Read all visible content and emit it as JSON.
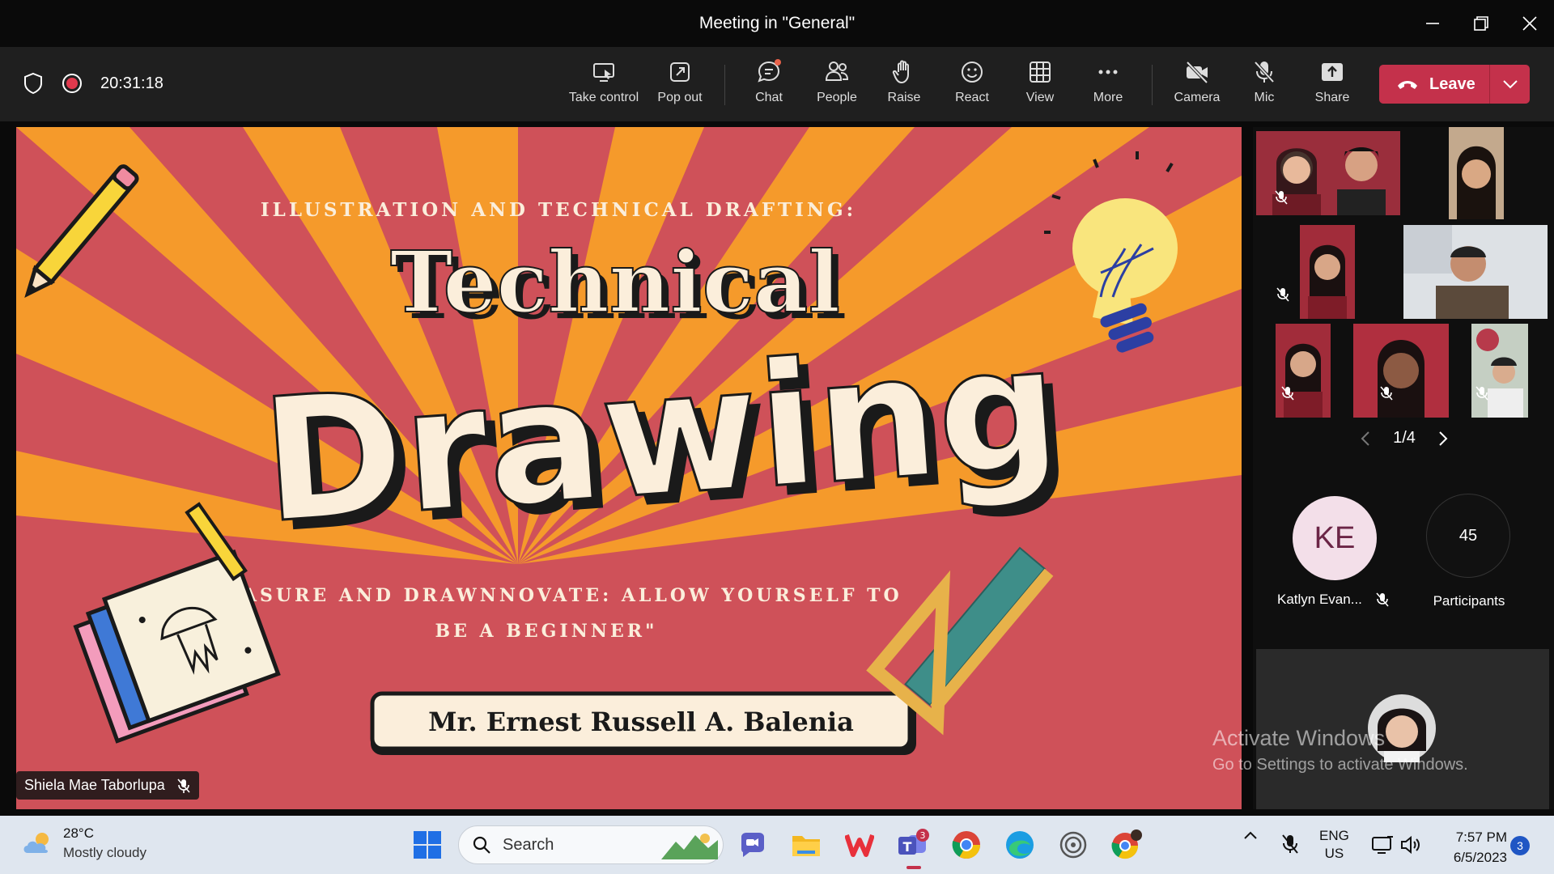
{
  "window": {
    "title": "Meeting in \"General\""
  },
  "toolbar": {
    "timer": "20:31:18",
    "buttons": [
      {
        "label": "Take control",
        "icon": "take-control-icon"
      },
      {
        "label": "Pop out",
        "icon": "pop-out-icon"
      },
      {
        "label": "Chat",
        "icon": "chat-icon"
      },
      {
        "label": "People",
        "icon": "people-icon"
      },
      {
        "label": "Raise",
        "icon": "raise-hand-icon"
      },
      {
        "label": "React",
        "icon": "react-icon"
      },
      {
        "label": "View",
        "icon": "grid-view-icon"
      },
      {
        "label": "More",
        "icon": "more-icon"
      },
      {
        "label": "Camera",
        "icon": "camera-off-icon"
      },
      {
        "label": "Mic",
        "icon": "mic-off-icon"
      },
      {
        "label": "Share",
        "icon": "share-icon"
      }
    ],
    "leave_label": "Leave"
  },
  "slide": {
    "subtitle": "ILLUSTRATION AND TECHNICAL DRAFTING:",
    "title_line1": "Technical",
    "title_line2": "Drawing",
    "quote_line1": "\"MEASURE AND DRAWNNOVATE: ALLOW YOURSELF TO",
    "quote_line2": "BE A BEGINNER\"",
    "presenter": "Mr. Ernest Russell A. Balenia"
  },
  "presenter_tag": "Shiela Mae Taborlupa",
  "sidebar": {
    "page": "1/4",
    "participant_initials": "KE",
    "participant_name": "Katlyn Evan...",
    "participants_count": "45",
    "participants_label": "Participants"
  },
  "watermark": {
    "line1": "Activate Windows",
    "line2": "Go to Settings to activate Windows."
  },
  "taskbar": {
    "weather_temp": "28°C",
    "weather_desc": "Mostly cloudy",
    "search_placeholder": "Search",
    "teams_badge": "3",
    "lang1": "ENG",
    "lang2": "US",
    "time": "7:57 PM",
    "date": "6/5/2023",
    "notifications": "3"
  },
  "colors": {
    "slide_background": "#cf5159",
    "slide_rays": "#f59a2b",
    "slide_text_cream": "#fbeedb",
    "leave_red": "#c4314b",
    "avatar_pink": "#f3dfe9"
  }
}
